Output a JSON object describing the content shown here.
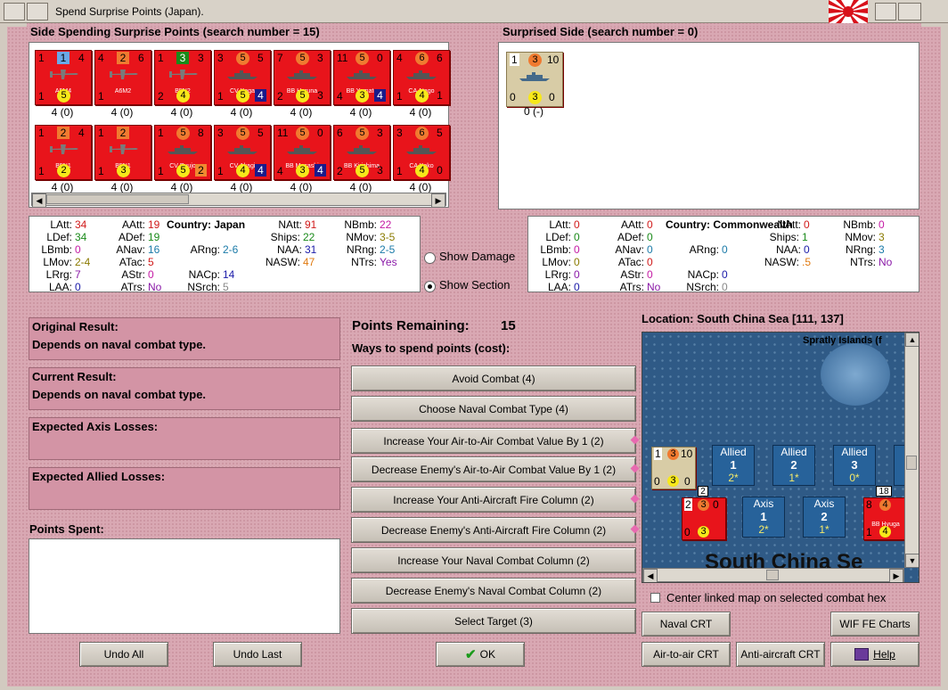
{
  "window": {
    "title": "Spend Surprise Points (Japan)."
  },
  "spending": {
    "heading": "Side Spending Surprise Points (search number = 15)",
    "units": [
      {
        "name": "A5M4",
        "tl": "1",
        "tm": "1",
        "tr": "4",
        "bl": "1",
        "bm": "5",
        "br": "",
        "cap": "4 (0)",
        "kind": "air"
      },
      {
        "name": "A6M2",
        "tl": "4",
        "tm": "2",
        "tr": "6",
        "bl": "1",
        "bm": "",
        "br": "",
        "cap": "4 (0)",
        "kind": "air"
      },
      {
        "name": "B5N2",
        "tl": "1",
        "tm": "3",
        "tr": "3",
        "bl": "2",
        "bm": "4",
        "br": "",
        "cap": "4 (0)",
        "kind": "air"
      },
      {
        "name": "CV Kaga",
        "tl": "3",
        "tm": "5",
        "tr": "5",
        "bl": "1",
        "bm": "5",
        "br": "4",
        "cap": "4 (0)",
        "kind": "ship"
      },
      {
        "name": "BB Haruna",
        "tl": "7",
        "tm": "5",
        "tr": "3",
        "bl": "2",
        "bm": "5",
        "br": "3",
        "cap": "4 (0)",
        "kind": "ship"
      },
      {
        "name": "BB Yamato",
        "tl": "11",
        "tm": "5",
        "tr": "0",
        "bl": "4",
        "bm": "3",
        "br": "4",
        "cap": "4 (0)",
        "kind": "ship"
      },
      {
        "name": "CA Atago",
        "tl": "4",
        "tm": "6",
        "tr": "6",
        "bl": "1",
        "bm": "4",
        "br": "1",
        "cap": "4 (0)",
        "kind": "ship"
      },
      {
        "name": "B5N1",
        "tl": "1",
        "tm": "2",
        "tr": "4",
        "bl": "1",
        "bm": "2",
        "br": "",
        "cap": "4 (0)",
        "kind": "air"
      },
      {
        "name": "B5N1",
        "tl": "1",
        "tm": "2",
        "tr": "",
        "bl": "1",
        "bm": "3",
        "br": "",
        "cap": "4 (0)",
        "kind": "air"
      },
      {
        "name": "CV Ryujo",
        "tl": "1",
        "tm": "5",
        "tr": "8",
        "bl": "1",
        "bm": "5",
        "br": "2",
        "cap": "4 (0)",
        "kind": "ship"
      },
      {
        "name": "CV Akagi",
        "tl": "3",
        "tm": "5",
        "tr": "5",
        "bl": "1",
        "bm": "4",
        "br": "4",
        "cap": "4 (0)",
        "kind": "ship"
      },
      {
        "name": "BB Musashi",
        "tl": "11",
        "tm": "5",
        "tr": "0",
        "bl": "4",
        "bm": "3",
        "br": "4",
        "cap": "4 (0)",
        "kind": "ship"
      },
      {
        "name": "BB Kirishima",
        "tl": "6",
        "tm": "5",
        "tr": "3",
        "bl": "2",
        "bm": "5",
        "br": "3",
        "cap": "4 (0)",
        "kind": "ship"
      },
      {
        "name": "CA Kako",
        "tl": "3",
        "tm": "6",
        "tr": "5",
        "bl": "1",
        "bm": "4",
        "br": "0",
        "cap": "4 (0)",
        "kind": "ship"
      }
    ]
  },
  "surprised": {
    "heading": "Surprised Side (search number = 0)",
    "unit": {
      "tl": "1",
      "tm": "3",
      "tr": "10",
      "bl": "0",
      "bm": "3",
      "br": "0",
      "cap": "0 (-)"
    }
  },
  "stats_left": {
    "country_label": "Country:",
    "country": "Japan",
    "items": [
      {
        "k": "LAtt:",
        "v": "34",
        "c": "#d01a1a"
      },
      {
        "k": "AAtt:",
        "v": "19",
        "c": "#d01a1a"
      },
      {
        "k": "NAtt:",
        "v": "91",
        "c": "#d01a1a"
      },
      {
        "k": "NBmb:",
        "v": "22",
        "c": "#c41aa4"
      },
      {
        "k": "LDef:",
        "v": "34",
        "c": "#1a8a1a"
      },
      {
        "k": "ADef:",
        "v": "19",
        "c": "#1a8a1a"
      },
      {
        "k": "Ships:",
        "v": "22",
        "c": "#1a8a1a"
      },
      {
        "k": "NMov:",
        "v": "3-5",
        "c": "#8a7a00"
      },
      {
        "k": "LBmb:",
        "v": "0",
        "c": "#c41aa4"
      },
      {
        "k": "ANav:",
        "v": "16",
        "c": "#1a7aa8"
      },
      {
        "k": "ARng:",
        "v": "2-6",
        "c": "#1a7aa8"
      },
      {
        "k": "NAA:",
        "v": "31",
        "c": "#1a1aa8"
      },
      {
        "k": "NRng:",
        "v": "2-5",
        "c": "#1a7aa8"
      },
      {
        "k": "LMov:",
        "v": "2-4",
        "c": "#8a7a00"
      },
      {
        "k": "ATac:",
        "v": "5",
        "c": "#d01a1a"
      },
      {
        "k": "NASW:",
        "v": "47",
        "c": "#e07a10"
      },
      {
        "k": "NTrs:",
        "v": "Yes",
        "c": "#8a1aa8"
      },
      {
        "k": "LRrg:",
        "v": "7",
        "c": "#8a1aa8"
      },
      {
        "k": "AStr:",
        "v": "0",
        "c": "#c41aa4"
      },
      {
        "k": "NACp:",
        "v": "14",
        "c": "#1a1aa8"
      },
      {
        "k": "LAA:",
        "v": "0",
        "c": "#1a1aa8"
      },
      {
        "k": "ATrs:",
        "v": "No",
        "c": "#8a1aa8"
      },
      {
        "k": "NSrch:",
        "v": "5",
        "c": "#888888"
      }
    ]
  },
  "stats_right": {
    "country_label": "Country:",
    "country": "Commonwealth",
    "items": [
      {
        "k": "LAtt:",
        "v": "0",
        "c": "#d01a1a"
      },
      {
        "k": "AAtt:",
        "v": "0",
        "c": "#d01a1a"
      },
      {
        "k": "NAtt:",
        "v": "0",
        "c": "#d01a1a"
      },
      {
        "k": "NBmb:",
        "v": "0",
        "c": "#c41aa4"
      },
      {
        "k": "LDef:",
        "v": "0",
        "c": "#1a8a1a"
      },
      {
        "k": "ADef:",
        "v": "0",
        "c": "#1a8a1a"
      },
      {
        "k": "Ships:",
        "v": "1",
        "c": "#1a8a1a"
      },
      {
        "k": "NMov:",
        "v": "3",
        "c": "#8a7a00"
      },
      {
        "k": "LBmb:",
        "v": "0",
        "c": "#c41aa4"
      },
      {
        "k": "ANav:",
        "v": "0",
        "c": "#1a7aa8"
      },
      {
        "k": "ARng:",
        "v": "0",
        "c": "#1a7aa8"
      },
      {
        "k": "NAA:",
        "v": "0",
        "c": "#1a1aa8"
      },
      {
        "k": "NRng:",
        "v": "3",
        "c": "#1a7aa8"
      },
      {
        "k": "LMov:",
        "v": "0",
        "c": "#8a7a00"
      },
      {
        "k": "ATac:",
        "v": "0",
        "c": "#d01a1a"
      },
      {
        "k": "NASW:",
        "v": ".5",
        "c": "#e07a10"
      },
      {
        "k": "NTrs:",
        "v": "No",
        "c": "#8a1aa8"
      },
      {
        "k": "LRrg:",
        "v": "0",
        "c": "#8a1aa8"
      },
      {
        "k": "AStr:",
        "v": "0",
        "c": "#c41aa4"
      },
      {
        "k": "NACp:",
        "v": "0",
        "c": "#1a1aa8"
      },
      {
        "k": "LAA:",
        "v": "0",
        "c": "#1a1aa8"
      },
      {
        "k": "ATrs:",
        "v": "No",
        "c": "#8a1aa8"
      },
      {
        "k": "NSrch:",
        "v": "0",
        "c": "#888888"
      }
    ]
  },
  "options": {
    "show_damage": "Show Damage",
    "show_section": "Show Section"
  },
  "results": {
    "original_label": "Original Result:",
    "original_value": "Depends on naval combat type.",
    "current_label": "Current Result:",
    "current_value": "Depends on naval combat type.",
    "axis_losses_label": "Expected Axis Losses:",
    "allied_losses_label": "Expected Allied Losses:",
    "points_spent_label": "Points Spent:"
  },
  "points": {
    "remaining_label": "Points Remaining:",
    "remaining_value": "15",
    "ways_label": "Ways to spend points (cost):"
  },
  "actions": [
    "Avoid Combat (4)",
    "Choose Naval Combat Type (4)",
    "Increase Your Air-to-Air Combat Value By 1 (2)",
    "Decrease Enemy's Air-to-Air Combat Value By 1 (2)",
    "Increase Your Anti-Aircraft Fire Column (2)",
    "Decrease Enemy's Anti-Aircraft Fire Column (2)",
    "Increase Your Naval Combat Column (2)",
    "Decrease Enemy's Naval Combat Column (2)",
    "Select Target (3)"
  ],
  "buttons": {
    "undo_all": "Undo All",
    "undo_last": "Undo Last",
    "ok": "OK",
    "naval_crt": "Naval CRT",
    "wif_charts": "WIF FE Charts",
    "air_crt": "Air-to-air CRT",
    "aa_crt": "Anti-aircraft CRT",
    "help": "Help"
  },
  "map": {
    "location": "Location: South China Sea [111, 137]",
    "island_label": "Spratly Islands (f",
    "sea_label": "South China Se",
    "center_linked": "Center linked map on selected combat hex",
    "boxes": [
      {
        "t": "Allied",
        "n": "1",
        "s": "2*"
      },
      {
        "t": "Allied",
        "n": "2",
        "s": "1*"
      },
      {
        "t": "Allied",
        "n": "3",
        "s": "0*"
      },
      {
        "t": "Axis",
        "n": "1",
        "s": "2*"
      },
      {
        "t": "Axis",
        "n": "2",
        "s": "1*"
      }
    ],
    "stack_left": "2",
    "stack_right": "18",
    "ally_counter": {
      "tl": "1",
      "tm": "3",
      "tr": "10",
      "bl": "0",
      "bm": "3",
      "br": "0"
    },
    "jap_counter": {
      "tl": "2",
      "tm": "3",
      "tr": "0",
      "bl": "0",
      "bm": "3",
      "br": ""
    },
    "jap_counter2": {
      "tl": "8",
      "tm": "4",
      "tr": "",
      "bl": "1",
      "bm": "4",
      "br": "",
      "name": "BB Hyuga"
    }
  }
}
